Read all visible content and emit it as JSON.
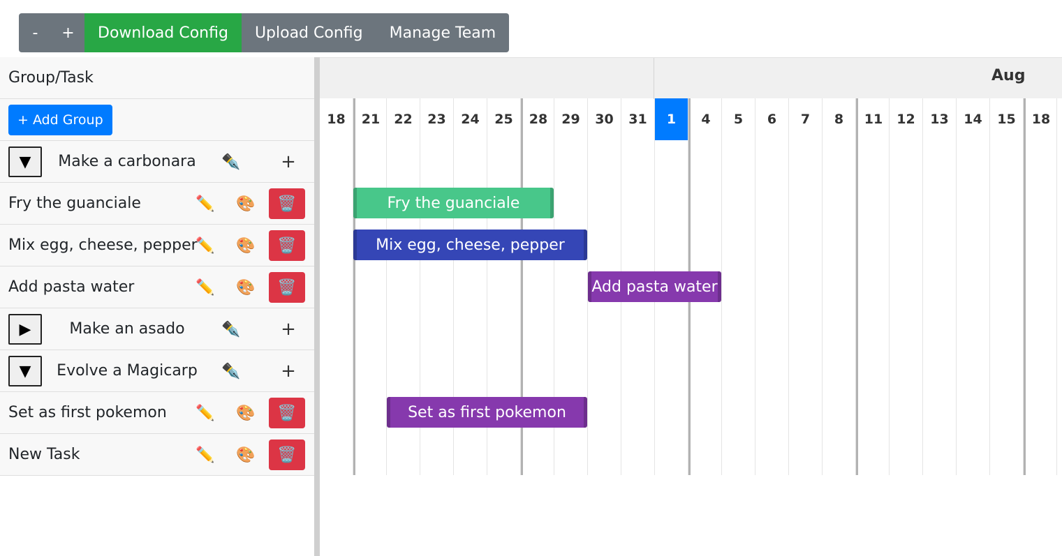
{
  "toolbar": {
    "zoom_out_label": "-",
    "zoom_in_label": "+",
    "download_label": "Download Config",
    "upload_label": "Upload Config",
    "team_label": "Manage Team"
  },
  "left_panel": {
    "header_title": "Group/Task",
    "add_group_label": "+ Add Group",
    "groups": [
      {
        "name": "Make a carbonara",
        "toggle": "▼",
        "edit_icon": "✒️",
        "add_label": "+",
        "tasks": [
          {
            "name": "Fry the guanciale",
            "edit_icon": "✏️",
            "color_icon": "🎨",
            "delete_icon": "🗑️"
          },
          {
            "name": "Mix egg, cheese, pepper",
            "edit_icon": "✏️",
            "color_icon": "🎨",
            "delete_icon": "🗑️"
          },
          {
            "name": "Add pasta water",
            "edit_icon": "✏️",
            "color_icon": "🎨",
            "delete_icon": "🗑️"
          }
        ]
      },
      {
        "name": "Make an asado",
        "toggle": "▶",
        "edit_icon": "✒️",
        "add_label": "+",
        "tasks": []
      },
      {
        "name": "Evolve a Magicarp",
        "toggle": "▼",
        "edit_icon": "✒️",
        "add_label": "+",
        "tasks": [
          {
            "name": "Set as first pokemon",
            "edit_icon": "✏️",
            "color_icon": "🎨",
            "delete_icon": "🗑️"
          },
          {
            "name": "New Task",
            "edit_icon": "✏️",
            "color_icon": "🎨",
            "delete_icon": "🗑️"
          }
        ]
      }
    ]
  },
  "gantt": {
    "month_label": "Aug",
    "days": [
      "18",
      "21",
      "22",
      "23",
      "24",
      "25",
      "28",
      "29",
      "30",
      "31",
      "1",
      "4",
      "5",
      "6",
      "7",
      "8",
      "11",
      "12",
      "13",
      "14",
      "15",
      "18"
    ],
    "today": "1",
    "week_starts": [
      "21",
      "28",
      "4",
      "11",
      "18"
    ],
    "bars": [
      {
        "label": "Fry the guanciale",
        "start": "21",
        "end": "28",
        "color": "#48c78a"
      },
      {
        "label": "Mix egg, cheese, pepper",
        "start": "21",
        "end": "29",
        "color": "#3546b6"
      },
      {
        "label": "Add pasta water",
        "start": "30",
        "end": "4",
        "color": "#8639ad"
      },
      {
        "label": "Set as first pokemon",
        "start": "22",
        "end": "29",
        "color": "#8639ad"
      }
    ]
  }
}
